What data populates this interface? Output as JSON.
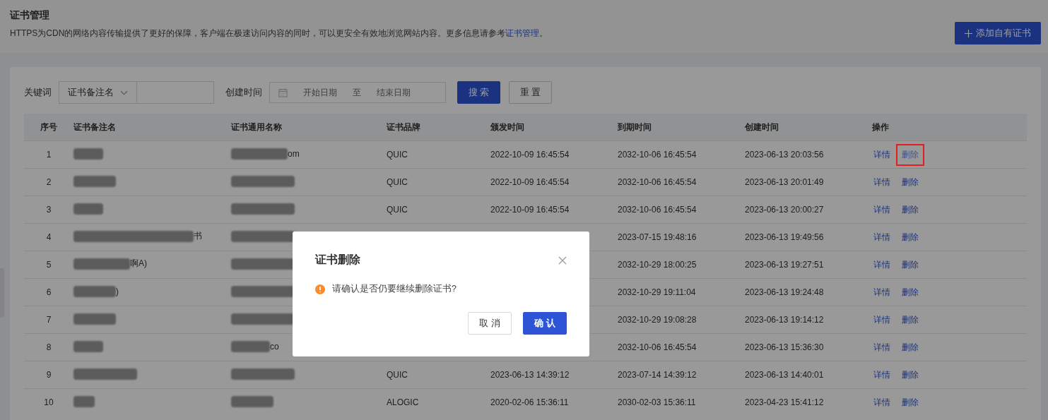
{
  "header": {
    "title": "证书管理",
    "description_prefix": "HTTPS为CDN的网络内容传输提供了更好的保障，客户端在极速访问内容的同时，可以更安全有效地浏览网站内容。更多信息请参考",
    "description_link": "证书管理",
    "description_suffix": "。",
    "add_button": "添加自有证书"
  },
  "filters": {
    "keyword_label": "关键词",
    "keyword_select": "证书备注名",
    "date_label": "创建时间",
    "start_placeholder": "开始日期",
    "range_separator": "至",
    "end_placeholder": "结束日期",
    "search_button": "搜 索",
    "reset_button": "重 置"
  },
  "table": {
    "columns": [
      "序号",
      "证书备注名",
      "证书通用名称",
      "证书品牌",
      "颁发时间",
      "到期时间",
      "创建时间",
      "操作"
    ],
    "rows": [
      {
        "index": "1",
        "common_name_tail": "om",
        "brand": "QUIC",
        "issued": "2022-10-09 16:45:54",
        "expires": "2032-10-06 16:45:54",
        "created": "2023-06-13 20:03:56",
        "detail": "详情",
        "delete": "删除",
        "delete_highlighted": true
      },
      {
        "index": "2",
        "brand": "QUIC",
        "issued": "2022-10-09 16:45:54",
        "expires": "2032-10-06 16:45:54",
        "created": "2023-06-13 20:01:49",
        "detail": "详情",
        "delete": "删除",
        "delete_highlighted": false
      },
      {
        "index": "3",
        "brand": "QUIC",
        "issued": "2022-10-09 16:45:54",
        "expires": "2032-10-06 16:45:54",
        "created": "2023-06-13 20:00:27",
        "detail": "详情",
        "delete": "删除",
        "delete_highlighted": false
      },
      {
        "index": "4",
        "remark_tail": "书",
        "expires": "2023-07-15 19:48:16",
        "created": "2023-06-13 19:49:56",
        "detail": "详情",
        "delete": "删除",
        "delete_highlighted": false
      },
      {
        "index": "5",
        "remark_tail": "啊A)",
        "expires": "2032-10-29 18:00:25",
        "created": "2023-06-13 19:27:51",
        "detail": "详情",
        "delete": "删除",
        "delete_highlighted": false
      },
      {
        "index": "6",
        "remark_tail": ")",
        "expires": "2032-10-29 19:11:04",
        "created": "2023-06-13 19:24:48",
        "detail": "详情",
        "delete": "删除",
        "delete_highlighted": false
      },
      {
        "index": "7",
        "expires": "2032-10-29 19:08:28",
        "created": "2023-06-13 19:14:12",
        "detail": "详情",
        "delete": "删除",
        "delete_highlighted": false
      },
      {
        "index": "8",
        "common_name_tail": "co",
        "expires": "2032-10-06 16:45:54",
        "created": "2023-06-13 15:36:30",
        "detail": "详情",
        "delete": "删除",
        "delete_highlighted": false
      },
      {
        "index": "9",
        "brand": "QUIC",
        "issued": "2023-06-13 14:39:12",
        "expires": "2023-07-14 14:39:12",
        "created": "2023-06-13 14:40:01",
        "detail": "详情",
        "delete": "删除",
        "delete_highlighted": false
      },
      {
        "index": "10",
        "brand": "ALOGIC",
        "issued": "2020-02-06 15:36:11",
        "expires": "2030-02-03 15:36:11",
        "created": "2023-04-23 15:41:12",
        "detail": "详情",
        "delete": "删除",
        "delete_highlighted": false
      }
    ]
  },
  "dialog": {
    "title": "证书删除",
    "message": "请确认是否仍要继续删除证书?",
    "cancel_button": "取 消",
    "confirm_button": "确 认"
  }
}
